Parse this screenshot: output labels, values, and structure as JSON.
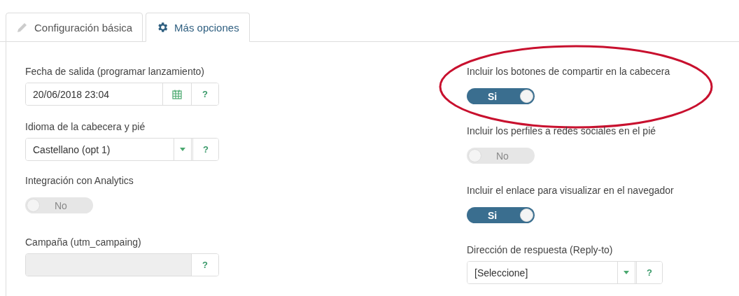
{
  "tabs": [
    {
      "label": "Configuración básica",
      "selected": false
    },
    {
      "label": "Más opciones",
      "selected": true
    }
  ],
  "left_fields": [
    {
      "kind": "date",
      "label": "Fecha de salida (programar lanzamiento)",
      "value": "20/06/2018 23:04",
      "help": "?"
    },
    {
      "kind": "select",
      "label": "Idioma de la cabecera y pié",
      "value": "Castellano (opt 1)",
      "help": "?"
    },
    {
      "kind": "toggle",
      "label": "Integración con Analytics",
      "on": false,
      "text": "No"
    },
    {
      "kind": "text",
      "label": "Campaña (utm_campaing)",
      "disabled": true,
      "help": "?"
    }
  ],
  "right_fields": [
    {
      "kind": "toggle",
      "label": "Incluir los botones de compartir en la cabecera",
      "on": true,
      "text": "Si",
      "highlighted": true
    },
    {
      "kind": "toggle",
      "label": "Incluir los perfiles a redes sociales en el pié",
      "on": false,
      "text": "No",
      "highlighted": false
    },
    {
      "kind": "toggle",
      "label": "Incluir el enlace para visualizar en el navegador",
      "on": true,
      "text": "Si",
      "highlighted": false
    },
    {
      "kind": "select",
      "label": "Dirección de respuesta (Reply-to)",
      "value": "[Seleccione]",
      "help": "?",
      "highlighted": false
    }
  ]
}
